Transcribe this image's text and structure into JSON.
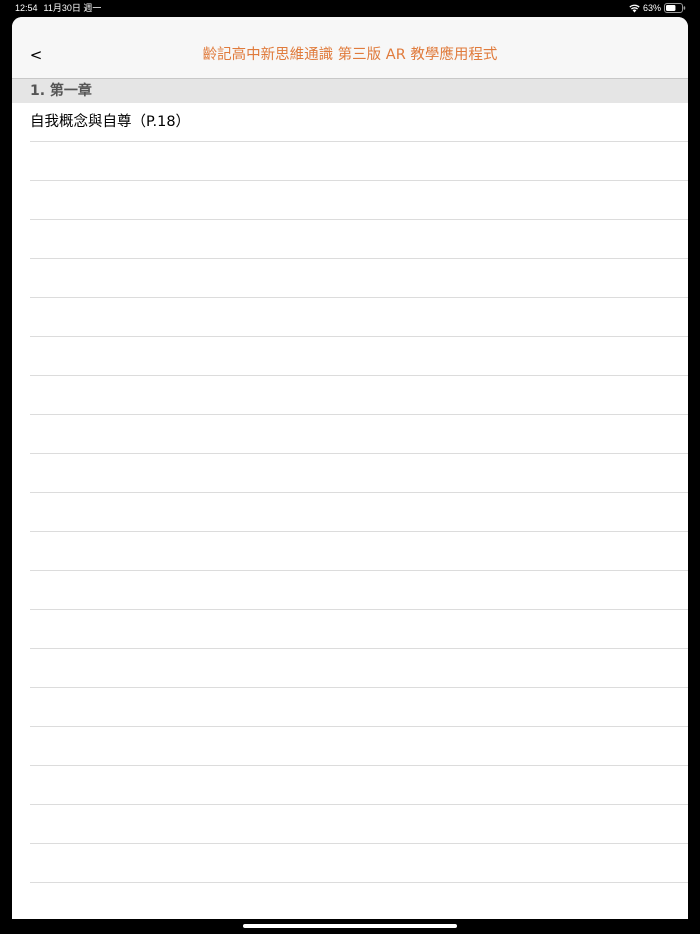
{
  "status_bar": {
    "time": "12:54",
    "date": "11月30日 週一",
    "battery": "63%",
    "battery_level": 0.63
  },
  "nav": {
    "back_label": "<",
    "title": "齡記高中新思維通識 第三版 AR 教學應用程式"
  },
  "section": {
    "title": "1. 第一章"
  },
  "rows": [
    {
      "label": "自我概念與自尊（P.18）"
    },
    {
      "label": ""
    },
    {
      "label": ""
    },
    {
      "label": ""
    },
    {
      "label": ""
    },
    {
      "label": ""
    },
    {
      "label": ""
    },
    {
      "label": ""
    },
    {
      "label": ""
    },
    {
      "label": ""
    },
    {
      "label": ""
    },
    {
      "label": ""
    },
    {
      "label": ""
    },
    {
      "label": ""
    },
    {
      "label": ""
    },
    {
      "label": ""
    },
    {
      "label": ""
    },
    {
      "label": ""
    },
    {
      "label": ""
    },
    {
      "label": ""
    }
  ],
  "colors": {
    "accent": "#e07b3c",
    "nav_background": "#f7f7f7",
    "section_background": "#e5e5e5",
    "separator": "#dcdcdc"
  }
}
